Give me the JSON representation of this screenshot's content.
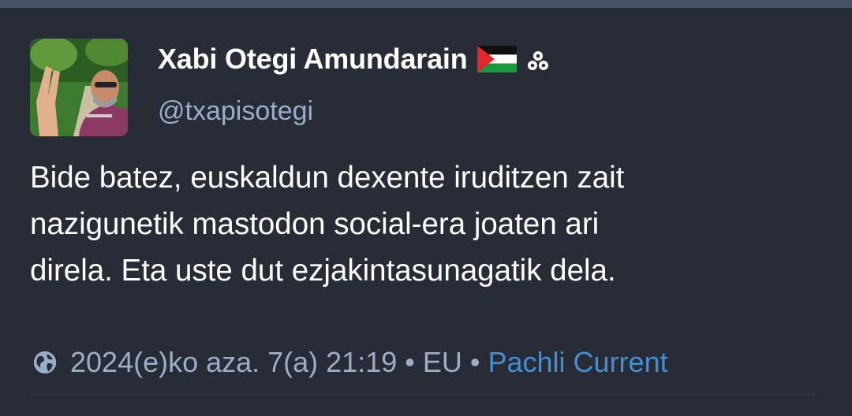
{
  "status": {
    "author": {
      "display_name": "Xabi Otegi Amundarain",
      "handle": "@txapisotegi",
      "badges": [
        "palestine-flag-icon",
        "three-dots-clover-icon"
      ]
    },
    "content": "Bide batez, euskaldun dexente iruditzen zait\nnazigunetik mastodon social-era joaten ari\ndirela. Eta uste dut ezjakintasunagatik dela.",
    "meta": {
      "visibility_icon": "globe-icon",
      "timestamp": "2024(e)ko aza. 7(a) 21:19",
      "separator": "•",
      "language": "EU",
      "application": "Pachli Current"
    }
  },
  "colors": {
    "background": "#282c37",
    "text": "#ffffff",
    "muted": "#9baec8",
    "link": "#3f8fd9"
  }
}
